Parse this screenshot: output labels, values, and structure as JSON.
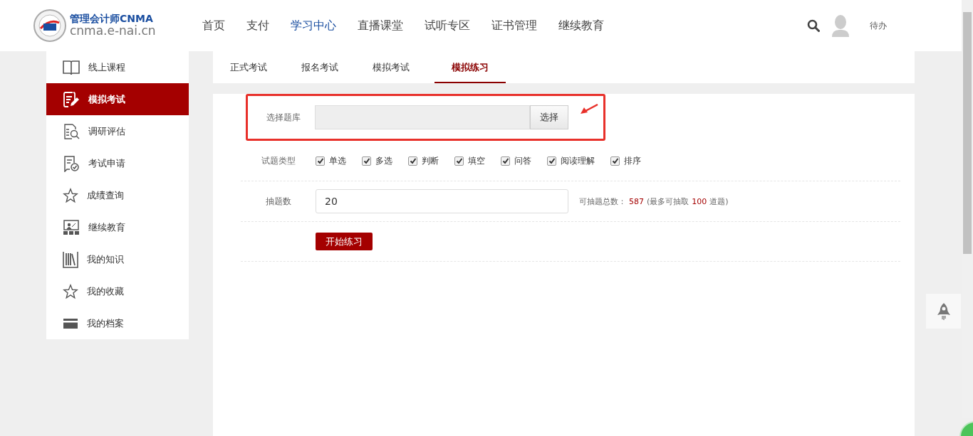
{
  "header": {
    "logo_title": "管理会计师CNMA",
    "logo_url": "cnma.e-nai.cn",
    "nav": [
      {
        "label": "首页",
        "selected": false
      },
      {
        "label": "支付",
        "selected": false
      },
      {
        "label": "学习中心",
        "selected": true
      },
      {
        "label": "直播课堂",
        "selected": false
      },
      {
        "label": "试听专区",
        "selected": false
      },
      {
        "label": "证书管理",
        "selected": false
      },
      {
        "label": "继续教育",
        "selected": false
      }
    ],
    "todo": "待办"
  },
  "sidebar": {
    "items": [
      {
        "label": "线上课程",
        "selected": false
      },
      {
        "label": "模拟考试",
        "selected": true
      },
      {
        "label": "调研评估",
        "selected": false
      },
      {
        "label": "考试申请",
        "selected": false
      },
      {
        "label": "成绩查询",
        "selected": false
      },
      {
        "label": "继续教育",
        "selected": false
      },
      {
        "label": "我的知识",
        "selected": false
      },
      {
        "label": "我的收藏",
        "selected": false
      },
      {
        "label": "我的档案",
        "selected": false
      }
    ]
  },
  "tabs": [
    {
      "label": "正式考试",
      "selected": false
    },
    {
      "label": "报名考试",
      "selected": false
    },
    {
      "label": "模拟考试",
      "selected": false
    },
    {
      "label": "模拟练习",
      "selected": true
    }
  ],
  "form": {
    "bank": {
      "label": "选择题库",
      "button": "选择",
      "highlighted": true
    },
    "types": {
      "label": "试题类型",
      "options": [
        {
          "label": "单选",
          "checked": true
        },
        {
          "label": "多选",
          "checked": true
        },
        {
          "label": "判断",
          "checked": true
        },
        {
          "label": "填空",
          "checked": true
        },
        {
          "label": "问答",
          "checked": true
        },
        {
          "label": "阅读理解",
          "checked": true
        },
        {
          "label": "排序",
          "checked": true
        }
      ]
    },
    "count": {
      "label": "抽题数",
      "value": "20",
      "note": [
        {
          "text": "可抽题总数：",
          "highlight": false
        },
        {
          "text": "587",
          "highlight": true
        },
        {
          "text": "(最多可抽取",
          "highlight": false
        },
        {
          "text": "100",
          "highlight": true
        },
        {
          "text": "道题)",
          "highlight": false
        }
      ]
    },
    "start_button": "开始练习"
  }
}
